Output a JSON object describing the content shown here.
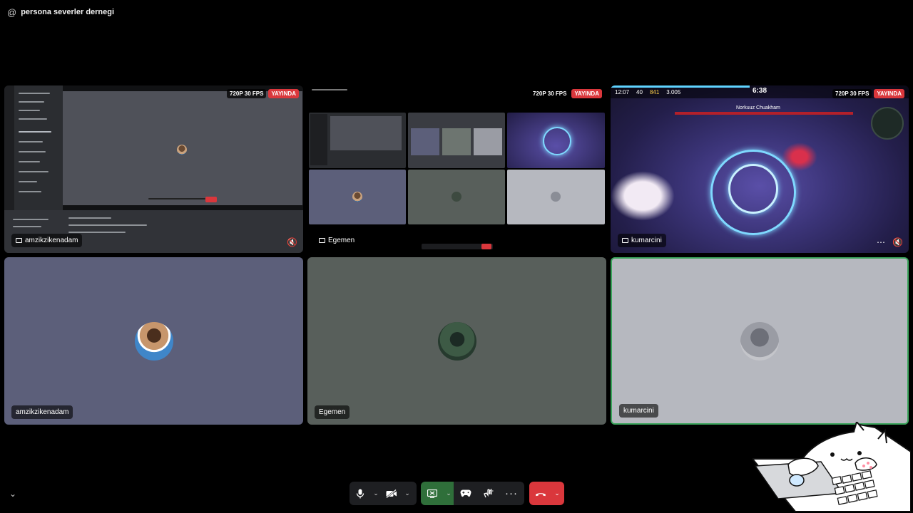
{
  "header": {
    "at_symbol": "@",
    "title": "persona severler dernegi"
  },
  "stream_badges": {
    "quality": "720P 30 FPS",
    "live": "YAYINDA"
  },
  "tiles": [
    {
      "name": "amzikzikenadam"
    },
    {
      "name": "Egemen"
    },
    {
      "name": "kumarcini"
    }
  ],
  "game_hud": {
    "time": "12:07",
    "kills": "40",
    "coins": "841",
    "score": "3.005",
    "timer": "6:38",
    "boss_name": "Norkuuz Chuakham"
  },
  "icons": {
    "mute": "speaker-muted-icon",
    "more": "more-icon",
    "mic": "microphone-icon",
    "camera": "camera-off-icon",
    "screen": "screen-share-icon",
    "activity": "game-controller-icon",
    "soundboard": "soundboard-icon",
    "hangup": "phone-hangup-icon",
    "collapse": "chevron-down-icon"
  },
  "colors": {
    "live_red": "#da373c",
    "hangup_red": "#da373c",
    "tile_blue": "#5c5f7a",
    "tile_gray": "#585f5b",
    "tile_light": "#b6b8bf",
    "screen_green": "#2f6f3a"
  }
}
